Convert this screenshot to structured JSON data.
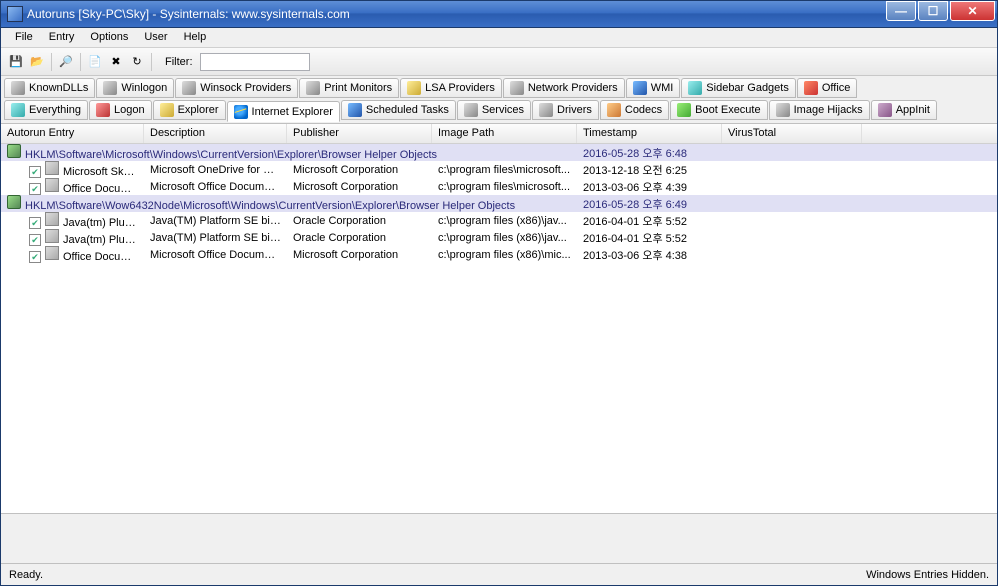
{
  "window": {
    "title": "Autoruns [Sky-PC\\Sky] - Sysinternals: www.sysinternals.com"
  },
  "menu": {
    "items": [
      "File",
      "Entry",
      "Options",
      "User",
      "Help"
    ]
  },
  "toolbar": {
    "buttons": [
      "save-icon",
      "open-icon",
      "find-icon",
      "jump-icon",
      "delete-icon",
      "refresh-icon"
    ],
    "filter_label": "Filter:",
    "filter_value": ""
  },
  "tabs": {
    "row1": [
      {
        "label": "KnownDLLs",
        "icon": "ic-gray",
        "name": "tab-knowndlls"
      },
      {
        "label": "Winlogon",
        "icon": "ic-gray",
        "name": "tab-winlogon"
      },
      {
        "label": "Winsock Providers",
        "icon": "ic-gray",
        "name": "tab-winsock"
      },
      {
        "label": "Print Monitors",
        "icon": "ic-gray",
        "name": "tab-printmonitors"
      },
      {
        "label": "LSA Providers",
        "icon": "ic-yellow",
        "name": "tab-lsaproviders"
      },
      {
        "label": "Network Providers",
        "icon": "ic-gray",
        "name": "tab-networkproviders"
      },
      {
        "label": "WMI",
        "icon": "ic-blue",
        "name": "tab-wmi"
      },
      {
        "label": "Sidebar Gadgets",
        "icon": "ic-cyan",
        "name": "tab-sidebargadgets"
      },
      {
        "label": "Office",
        "icon": "ic-office",
        "name": "tab-office"
      }
    ],
    "row2": [
      {
        "label": "Everything",
        "icon": "ic-cyan",
        "name": "tab-everything"
      },
      {
        "label": "Logon",
        "icon": "ic-red",
        "name": "tab-logon"
      },
      {
        "label": "Explorer",
        "icon": "ic-yellow",
        "name": "tab-explorer"
      },
      {
        "label": "Internet Explorer",
        "icon": "ic-ie",
        "name": "tab-internetexplorer",
        "active": true
      },
      {
        "label": "Scheduled Tasks",
        "icon": "ic-blue",
        "name": "tab-scheduledtasks"
      },
      {
        "label": "Services",
        "icon": "ic-gray",
        "name": "tab-services"
      },
      {
        "label": "Drivers",
        "icon": "ic-gray",
        "name": "tab-drivers"
      },
      {
        "label": "Codecs",
        "icon": "ic-orange",
        "name": "tab-codecs"
      },
      {
        "label": "Boot Execute",
        "icon": "ic-green",
        "name": "tab-bootexecute"
      },
      {
        "label": "Image Hijacks",
        "icon": "ic-gray",
        "name": "tab-imagehijacks"
      },
      {
        "label": "AppInit",
        "icon": "ic-purple",
        "name": "tab-appinit"
      }
    ]
  },
  "columns": [
    "Autorun Entry",
    "Description",
    "Publisher",
    "Image Path",
    "Timestamp",
    "VirusTotal"
  ],
  "rows": [
    {
      "type": "group",
      "entry": "HKLM\\Software\\Microsoft\\Windows\\CurrentVersion\\Explorer\\Browser Helper Objects",
      "time": "2016-05-28 오후 6:48"
    },
    {
      "type": "item",
      "checked": true,
      "entry": "Microsoft SkyD...",
      "desc": "Microsoft OneDrive for Busi...",
      "pub": "Microsoft Corporation",
      "path": "c:\\program files\\microsoft...",
      "time": "2013-12-18 오전 6:25"
    },
    {
      "type": "item",
      "checked": true,
      "entry": "Office Docume...",
      "desc": "Microsoft Office Document ...",
      "pub": "Microsoft Corporation",
      "path": "c:\\program files\\microsoft...",
      "time": "2013-03-06 오후 4:39"
    },
    {
      "type": "group",
      "entry": "HKLM\\Software\\Wow6432Node\\Microsoft\\Windows\\CurrentVersion\\Explorer\\Browser Helper Objects",
      "time": "2016-05-28 오후 6:49"
    },
    {
      "type": "item",
      "checked": true,
      "entry": "Java(tm) Plug-I...",
      "desc": "Java(TM) Platform SE binary",
      "pub": "Oracle Corporation",
      "path": "c:\\program files (x86)\\jav...",
      "time": "2016-04-01 오후 5:52"
    },
    {
      "type": "item",
      "checked": true,
      "entry": "Java(tm) Plug-I...",
      "desc": "Java(TM) Platform SE binary",
      "pub": "Oracle Corporation",
      "path": "c:\\program files (x86)\\jav...",
      "time": "2016-04-01 오후 5:52"
    },
    {
      "type": "item",
      "checked": true,
      "entry": "Office Docume...",
      "desc": "Microsoft Office Document ...",
      "pub": "Microsoft Corporation",
      "path": "c:\\program files (x86)\\mic...",
      "time": "2013-03-06 오후 4:38"
    }
  ],
  "status": {
    "left": "Ready.",
    "right": "Windows Entries Hidden."
  }
}
